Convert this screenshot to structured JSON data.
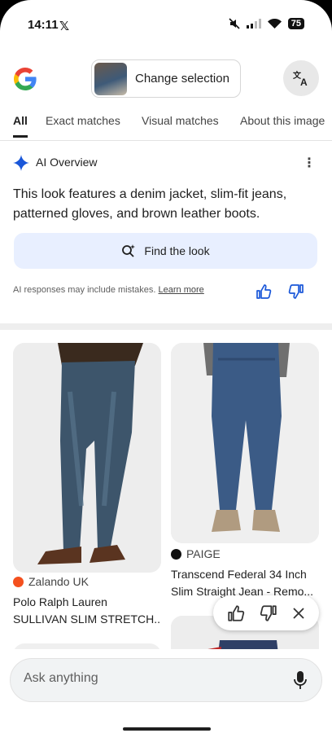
{
  "status": {
    "time": "14:11",
    "battery": "75"
  },
  "header": {
    "change_selection": "Change selection"
  },
  "tabs": [
    {
      "label": "All"
    },
    {
      "label": "Exact matches"
    },
    {
      "label": "Visual matches"
    },
    {
      "label": "About this image"
    }
  ],
  "ai_overview": {
    "title": "AI Overview",
    "text": "This look features a denim jacket, slim-fit jeans, patterned gloves, and brown leather boots.",
    "find_the_look": "Find the look",
    "disclaimer": "AI responses may include mistakes.",
    "learn_more": "Learn more"
  },
  "products": [
    {
      "merchant": "Zalando UK",
      "merchant_color": "#f4501e",
      "title_line1": "Polo Ralph Lauren",
      "title_line2": "SULLIVAN SLIM STRETCH..."
    },
    {
      "merchant": "PAIGE",
      "merchant_color": "#111111",
      "title_line1": "Transcend Federal 34 Inch",
      "title_line2": "Slim Straight Jean - Remo..."
    }
  ],
  "search": {
    "placeholder": "Ask anything"
  },
  "icons": {
    "translate": "translate-icon",
    "thumbs_up": "thumbs-up-icon",
    "thumbs_down": "thumbs-down-icon",
    "close": "close-icon",
    "mic": "mic-icon",
    "sparkle": "gemini-sparkle-icon"
  },
  "colors": {
    "accent_blue": "#1a57d9",
    "find_look_bg": "#e8efff"
  }
}
